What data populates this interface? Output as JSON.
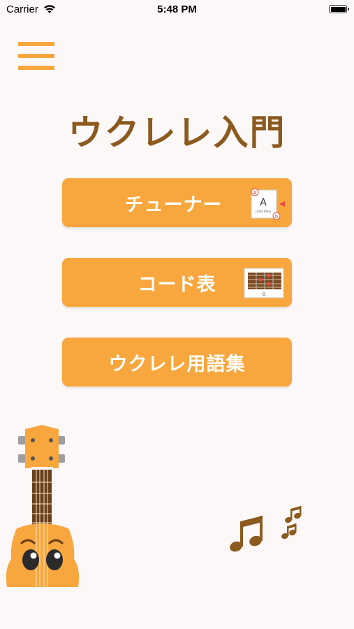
{
  "status_bar": {
    "carrier": "Carrier",
    "time": "5:48 PM"
  },
  "menu": {
    "icon": "hamburger-menu-icon"
  },
  "app_title": "ウクレレ入門",
  "buttons": {
    "tuner": {
      "label": "チューナー",
      "icon_note": "A",
      "icon_freq": "(440.0Hz)",
      "icon_sharp": "#",
      "icon_flat": "b"
    },
    "chord": {
      "label": "コード表",
      "icon_chord": "G"
    },
    "glossary": {
      "label": "ウクレレ用語集"
    }
  },
  "colors": {
    "accent": "#f8a73e",
    "title": "#8b5a1e",
    "background": "#fdf8f8",
    "text_on_button": "#ffffff"
  }
}
